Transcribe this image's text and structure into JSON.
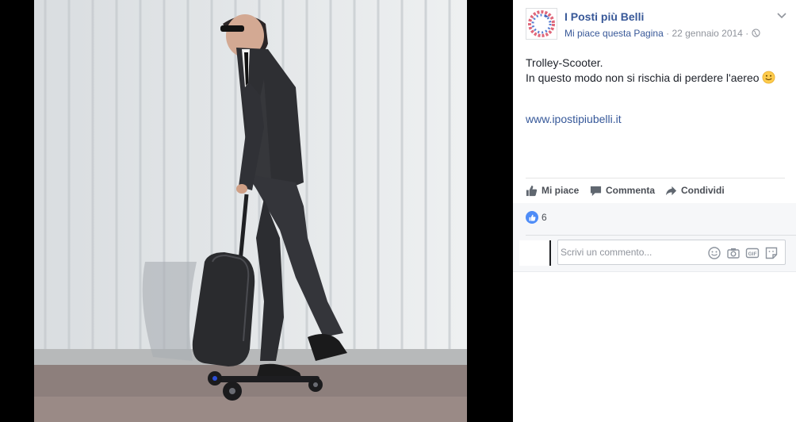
{
  "post": {
    "page_name": "I Posti più Belli",
    "like_page_label": "Mi piace questa Pagina",
    "date": "22 gennaio 2014",
    "meta_separator": "·",
    "text_line_1": "Trolley-Scooter.",
    "text_line_2": "In questo modo non si rischia di perdere l'aereo",
    "link": "www.ipostipiubelli.it"
  },
  "actions": {
    "like": "Mi piace",
    "comment": "Commenta",
    "share": "Condividi"
  },
  "reactions": {
    "count": "6"
  },
  "comment_input": {
    "placeholder": "Scrivi un commento..."
  },
  "colors": {
    "brand_blue": "#385898",
    "like_blue": "#4e8cf7",
    "text_grey": "#90949c",
    "action_grey": "#4b4f56"
  },
  "icons": {
    "privacy": "globe-icon",
    "chevron": "chevron-down-icon",
    "emoji": "smiley-icon",
    "like": "thumbs-up-icon",
    "comment": "speech-bubble-icon",
    "share": "share-arrow-icon",
    "camera": "camera-icon",
    "gif": "gif-icon",
    "sticker": "sticker-icon"
  }
}
